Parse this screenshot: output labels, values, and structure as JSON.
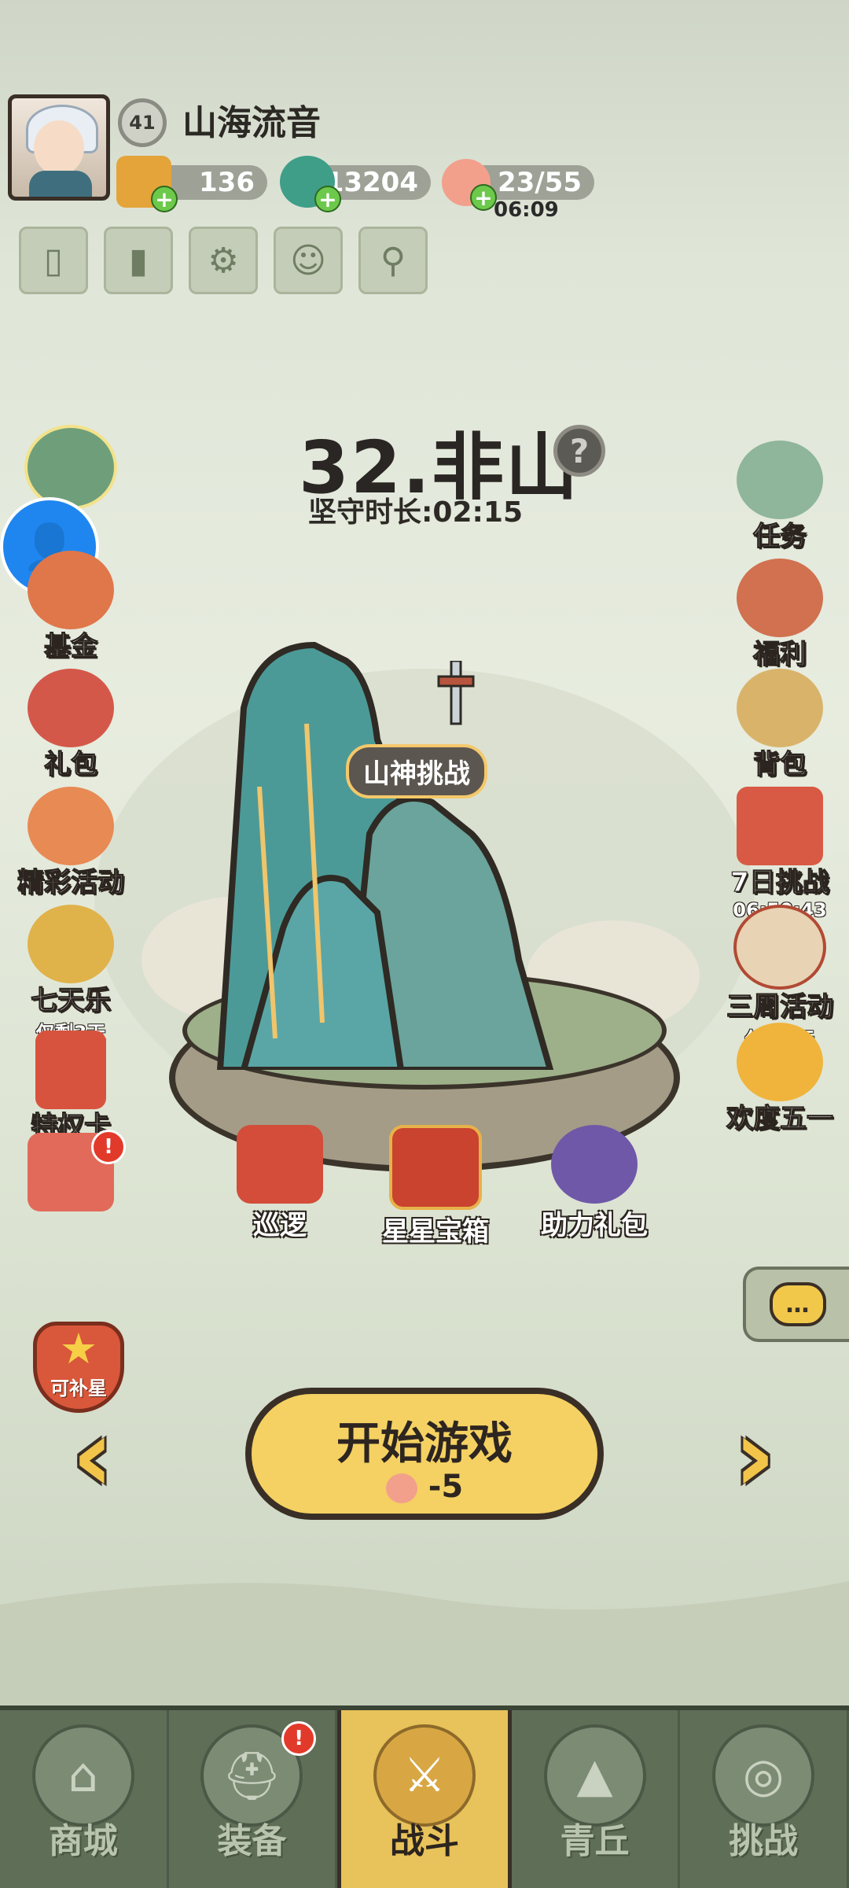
{
  "player": {
    "level": "41",
    "name": "山海流音"
  },
  "resources": {
    "ticket": "136",
    "jade": "13204",
    "stamina": "23/55",
    "stamina_timer": "06:09"
  },
  "stage": {
    "title": "32.非山",
    "guard_label": "坚守时长:02:15"
  },
  "left_menu": [
    {
      "label": "基金"
    },
    {
      "label": "礼包"
    },
    {
      "label": "精彩活动"
    },
    {
      "label": "七天乐",
      "sub": "仅剩3天"
    },
    {
      "label": "特权卡"
    }
  ],
  "right_menu": [
    {
      "label": "任务"
    },
    {
      "label": "福利"
    },
    {
      "label": "背包"
    },
    {
      "label": "7日挑战",
      "sub": "06:50:43"
    },
    {
      "label": "三周活动",
      "sub": "仅剩3天"
    },
    {
      "label": "欢度五一"
    }
  ],
  "center": {
    "sword_label": "山神挑战",
    "patrol": "巡逻",
    "star_chest": "星星宝箱",
    "assist_pack": "助力礼包"
  },
  "star_badge": "可补星",
  "start_button": {
    "label": "开始游戏",
    "cost": "-5"
  },
  "nav": [
    {
      "label": "商城"
    },
    {
      "label": "装备"
    },
    {
      "label": "战斗"
    },
    {
      "label": "青丘"
    },
    {
      "label": "挑战"
    }
  ],
  "colors": {
    "accent": "#f4d162",
    "nav_bg": "#5e6e57",
    "alert": "#e23a2a"
  }
}
